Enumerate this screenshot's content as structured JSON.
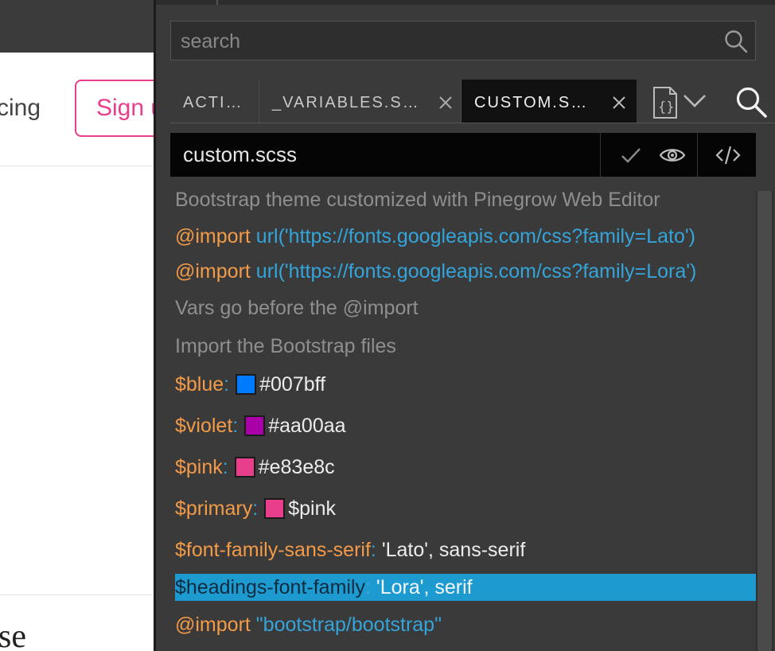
{
  "preview": {
    "nav_link_fragment": "cing",
    "signup_label": "Sign up",
    "heading_fragment": "se"
  },
  "panel": {
    "search": {
      "placeholder": "search"
    },
    "tabs": [
      {
        "label": "ACTI…",
        "active": false
      },
      {
        "label": "_VARIABLES.S…",
        "active": false
      },
      {
        "label": "CUSTOM.S…",
        "active": true
      }
    ],
    "file": {
      "name": "custom.scss"
    },
    "code": {
      "line1": "Bootstrap theme customized with Pinegrow Web Editor",
      "line2": {
        "kw": "@import",
        "url": "url('https://fonts.googleapis.com/css?family=Lato')"
      },
      "line3": {
        "kw": "@import",
        "url": "url('https://fonts.googleapis.com/css?family=Lora')"
      },
      "line4": "Vars go before the @import",
      "line5": "Import the Bootstrap files",
      "vars": [
        {
          "name": "$blue",
          "value": "#007bff",
          "swatch": "#007bff"
        },
        {
          "name": "$violet",
          "value": "#aa00aa",
          "swatch": "#aa00aa"
        },
        {
          "name": "$pink",
          "value": "#e83e8c",
          "swatch": "#e83e8c"
        },
        {
          "name": "$primary",
          "value": "$pink",
          "swatch": "#e83e8c"
        }
      ],
      "font_sans": {
        "name": "$font-family-sans-serif",
        "value": "'Lato', sans-serif"
      },
      "font_headings": {
        "name": "$headings-font-family",
        "value": "'Lora', serif"
      },
      "last_import": {
        "kw": "@import",
        "value": "\"bootstrap/bootstrap\""
      },
      "colon": ":"
    }
  },
  "icons": {
    "search": "search-icon",
    "close": "close-icon",
    "file_code": "file-code-icon",
    "chevron": "chevron-down-icon",
    "check": "check-icon",
    "eye": "eye-icon",
    "code": "code-icon"
  },
  "colors": {
    "accent_pink": "#e83e8c",
    "selection": "#1d9bd1",
    "keyword": "#f39b48",
    "url": "#34a4da"
  }
}
